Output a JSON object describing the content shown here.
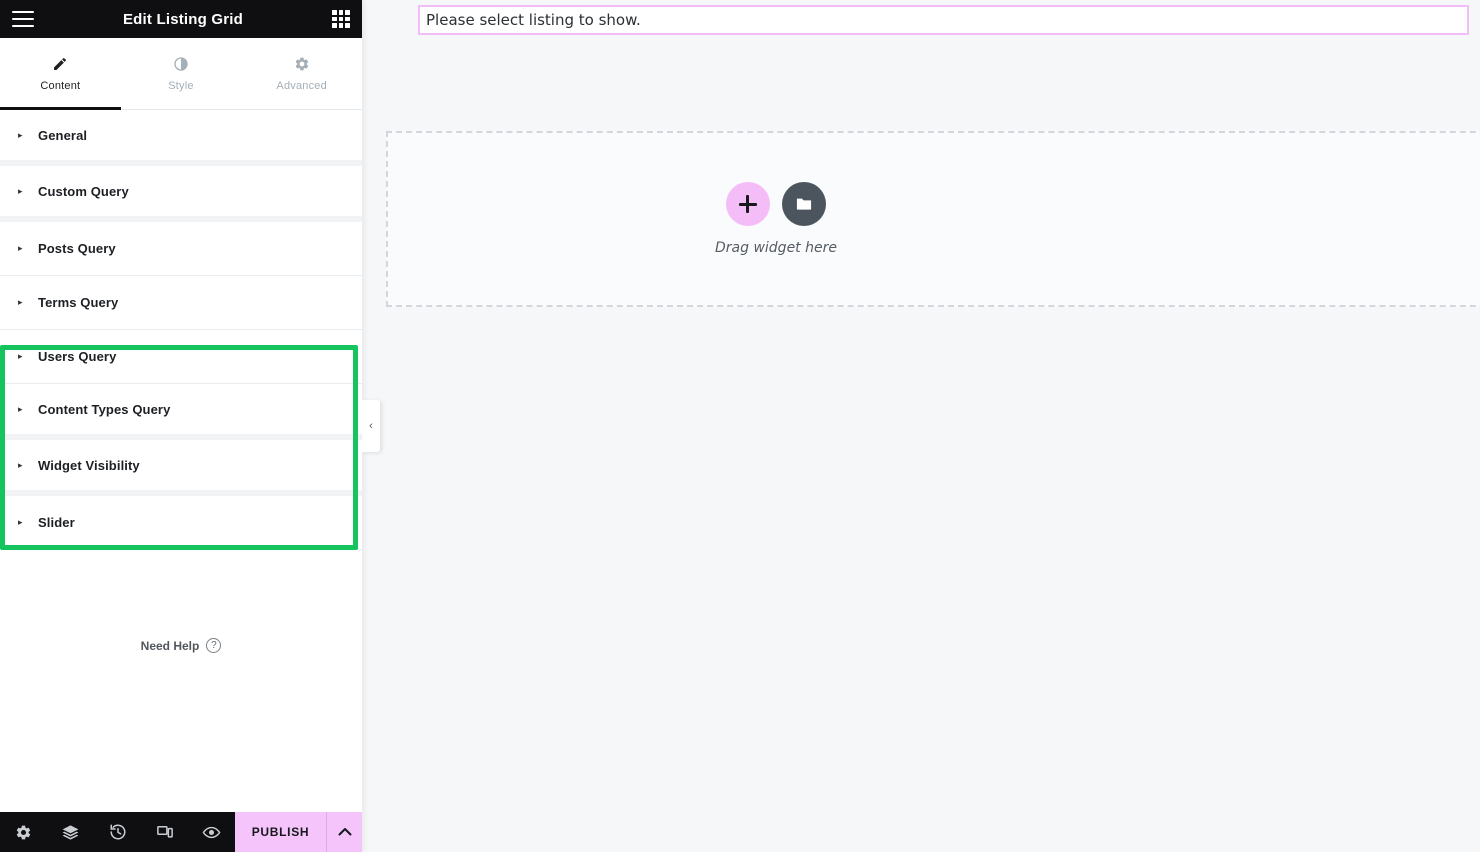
{
  "panel": {
    "header": {
      "title": "Edit Listing Grid",
      "menu_icon": "hamburger-icon",
      "apps_icon": "apps-grid-icon"
    },
    "tabs": [
      {
        "label": "Content",
        "icon": "pencil-icon",
        "active": true
      },
      {
        "label": "Style",
        "icon": "contrast-icon",
        "active": false
      },
      {
        "label": "Advanced",
        "icon": "gear-icon",
        "active": false
      }
    ],
    "sections": [
      {
        "label": "General",
        "key": "general",
        "highlighted": false
      },
      {
        "label": "Custom Query",
        "key": "custom-query",
        "highlighted": false
      },
      {
        "label": "Posts Query",
        "key": "posts-query",
        "highlighted": true
      },
      {
        "label": "Terms Query",
        "key": "terms-query",
        "highlighted": true
      },
      {
        "label": "Users Query",
        "key": "users-query",
        "highlighted": true
      },
      {
        "label": "Content Types Query",
        "key": "content-types-query",
        "highlighted": true
      },
      {
        "label": "Widget Visibility",
        "key": "widget-visibility",
        "highlighted": false
      },
      {
        "label": "Slider",
        "key": "slider",
        "highlighted": false
      }
    ],
    "caret_glyph": "▸",
    "need_help": {
      "label": "Need Help",
      "icon": "question-circle-icon",
      "glyph": "?"
    },
    "footer": {
      "tools": [
        {
          "name": "settings-icon",
          "title": "Settings"
        },
        {
          "name": "navigator-icon",
          "title": "Navigator"
        },
        {
          "name": "history-icon",
          "title": "History"
        },
        {
          "name": "responsive-icon",
          "title": "Responsive Mode"
        },
        {
          "name": "preview-icon",
          "title": "Preview Changes"
        }
      ],
      "publish_label": "PUBLISH",
      "publish_caret": "⌃"
    },
    "collapse_handle": {
      "glyph": "‹"
    }
  },
  "canvas": {
    "notice": {
      "text": "Please select listing to show."
    },
    "dropzone": {
      "add_label": "+",
      "folder_icon": "folder-icon",
      "hint": "Drag widget here"
    }
  },
  "colors": {
    "highlight_green": "#15c45e",
    "accent_pink": "#f4c4fa",
    "notice_border": "#f3bdf7",
    "header_dark": "#0f0f11",
    "canvas_bg": "#f6f7f9"
  }
}
